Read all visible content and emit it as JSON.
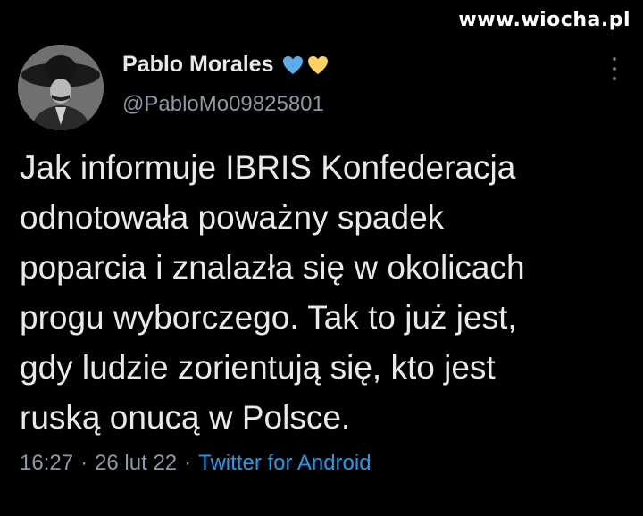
{
  "watermark": "www.wiocha.pl",
  "tweet": {
    "display_name": "Pablo Morales",
    "handle": "@PabloMo09825801",
    "badges": [
      {
        "icon": "blue-heart-icon",
        "color": "#5dadec"
      },
      {
        "icon": "yellow-heart-icon",
        "color": "#ffd35b"
      }
    ],
    "text": "Jak informuje IBRIS Konfederacja\nodnotowała poważny spadek\npoparcia i znalazła się w okolicach\nprogu wyborczego. Tak to już jest,\ngdy ludzie zorientują się, kto jest\nruską onucą w Polsce.",
    "time": "16:27",
    "date": "26 lut 22",
    "separator": "·",
    "source": "Twitter for Android"
  },
  "colors": {
    "background": "#000000",
    "text": "#e7e9ea",
    "secondary": "#8b98a5",
    "link": "#1d9bf0"
  },
  "icons": {
    "more": "more-vertical-icon",
    "avatar": "profile-avatar"
  }
}
